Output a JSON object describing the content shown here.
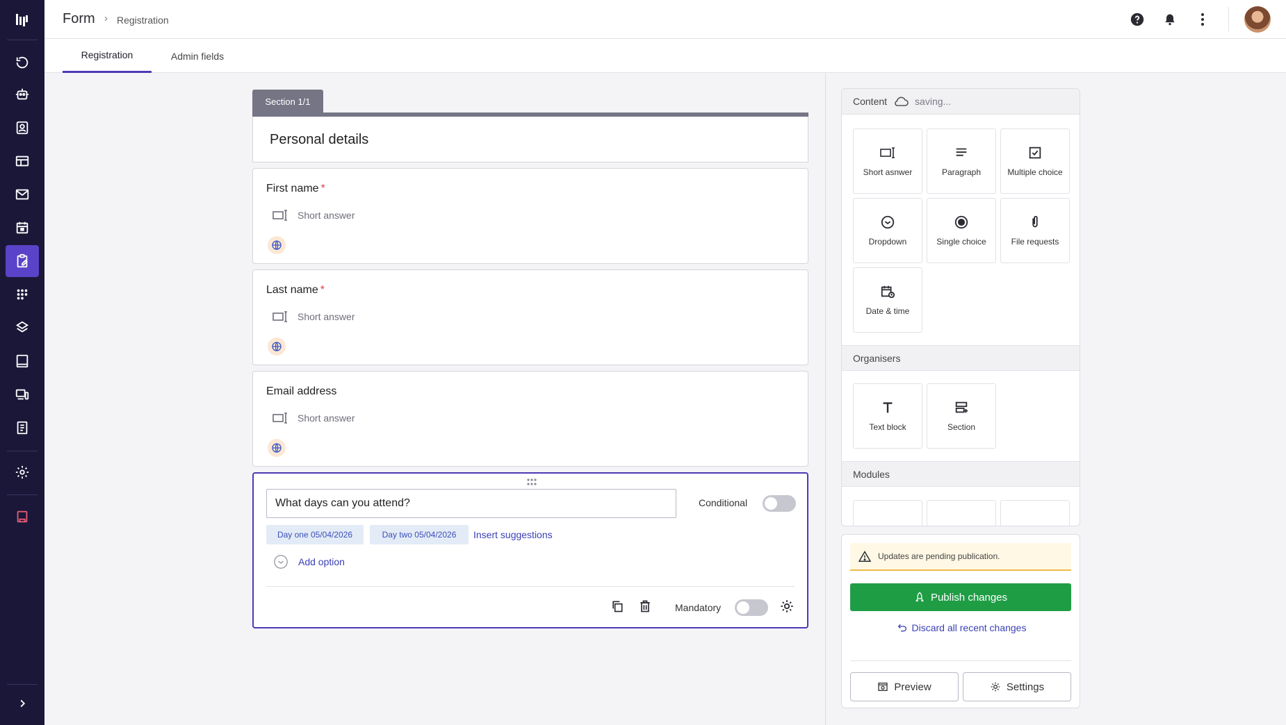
{
  "header": {
    "title": "Form",
    "breadcrumb_sep": "›",
    "breadcrumb": "Registration"
  },
  "tabs": [
    {
      "label": "Registration",
      "active": true
    },
    {
      "label": "Admin fields",
      "active": false
    }
  ],
  "nav": {
    "items": [
      "refresh-icon",
      "robot-icon",
      "contacts-icon",
      "layout-icon",
      "mail-icon",
      "calendar-icon",
      "form-clipboard-icon",
      "apps-grid-icon",
      "badge-icon",
      "tablet-icon",
      "devices-icon",
      "document-icon",
      "settings-icon",
      "bookmark-icon"
    ],
    "active": "form-clipboard-icon",
    "accent_color": "#5a43c8"
  },
  "section": {
    "tab_label": "Section 1/1",
    "title": "Personal details"
  },
  "questions": [
    {
      "label": "First name",
      "required_mark": "*",
      "type": "Short answer"
    },
    {
      "label": "Last name",
      "required_mark": "*",
      "type": "Short answer"
    },
    {
      "label": "Email address",
      "type": "Short answer"
    }
  ],
  "active_question": {
    "text": "What days can you attend?",
    "conditional_label": "Conditional",
    "options": [
      "Day one 05/04/2026",
      "Day two 05/04/2026"
    ],
    "insert_suggestions": "Insert suggestions",
    "add_option": "Add option",
    "mandatory_label": "Mandatory",
    "conditional_on": false,
    "mandatory_on": false
  },
  "palette": {
    "content_title": "Content",
    "saving_text": "saving...",
    "content_items": [
      {
        "label": "Short asnwer",
        "icon": "short-answer-icon"
      },
      {
        "label": "Paragraph",
        "icon": "paragraph-icon"
      },
      {
        "label": "Multiple choice",
        "icon": "checkbox-icon"
      },
      {
        "label": "Dropdown",
        "icon": "dropdown-icon"
      },
      {
        "label": "Single choice",
        "icon": "radio-icon"
      },
      {
        "label": "File requests",
        "icon": "paperclip-icon"
      },
      {
        "label": "Date & time",
        "icon": "calendar-clock-icon"
      }
    ],
    "organisers_title": "Organisers",
    "organiser_items": [
      {
        "label": "Text block",
        "icon": "text-icon"
      },
      {
        "label": "Section",
        "icon": "section-icon"
      }
    ],
    "modules_title": "Modules"
  },
  "publish": {
    "warning": "Updates are pending publication.",
    "publish_label": "Publish changes",
    "discard_label": "Discard all recent changes",
    "preview_label": "Preview",
    "settings_label": "Settings",
    "publish_color": "#1f9d45",
    "warning_color": "#f0b945"
  }
}
